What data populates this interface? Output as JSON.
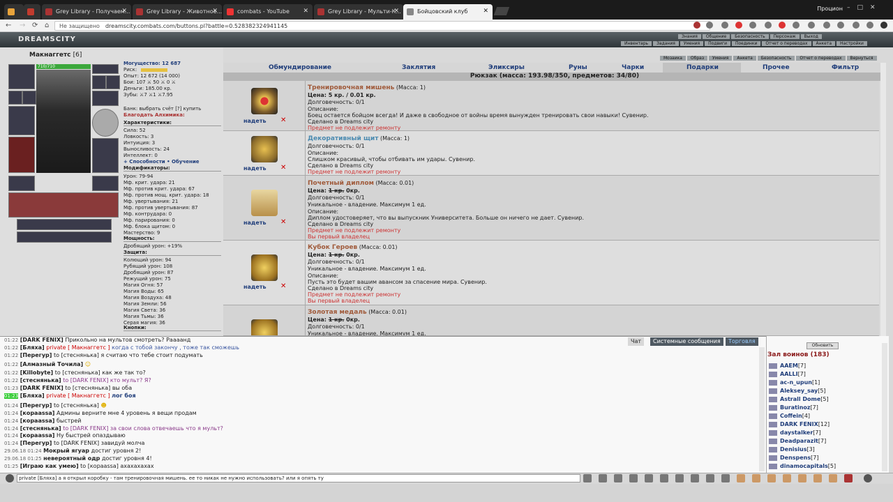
{
  "browser": {
    "tabs": [
      {
        "label": "Grey Library - Получаем..."
      },
      {
        "label": "Grey Library - Животное..."
      },
      {
        "label": "combats - YouTube"
      },
      {
        "label": "Grey Library - Мульти-К..."
      },
      {
        "label": "Бойцовский клуб"
      }
    ],
    "profile": "Процион",
    "security": "Не защищено",
    "url": "dreamscity.combats.com/buttons.pl?battle=0.528382324941145"
  },
  "game": {
    "logo": "DREAMSCITY",
    "menu_top": [
      "Знания",
      "Общение",
      "Безопасность",
      "Персонаж",
      "Выход"
    ],
    "menu_bottom": [
      "Инвентарь",
      "Задания",
      "Умения",
      "Подвиги",
      "Поединки",
      "Отчет о переводах",
      "Анкета",
      "Настройки"
    ],
    "menu_inv": [
      "Мозаика",
      "Образ",
      "Умения",
      "Анкета",
      "Безопасность",
      "Отчет о переводах",
      "Вернуться"
    ]
  },
  "character": {
    "name": "Макнаггетс",
    "level": "[6]",
    "hp": "710/710",
    "stats": [
      "Могущество: 12 687",
      "Риск:",
      "Опыт: 12 672 (14 000)",
      "Бои: 107 ⚔ 50 ⚔ 0 ⚔",
      "Деньги: 185.00 кр.",
      "Зубы: ⚔7 ⚔1 ⚔7.95"
    ],
    "bank": "Банк: выбрать счёт [?] купить",
    "blessing": "Благодать Алхимика:",
    "characteristics_title": "Характеристики:",
    "characteristics": [
      "Сила: 52",
      "Ловкость: 3",
      "Интуиция: 3",
      "Выносливость: 24",
      "Интеллект: 0"
    ],
    "links": "+ Способности • Обучение",
    "modifiers_title": "Модификаторы:",
    "modifiers": [
      "Урон: 79-94",
      "Мф. крит. удара: 21",
      "Мф. против крит. удара: 67",
      "Мф. против мощ. крит. удара: 18",
      "Мф. увертывания: 21",
      "Мф. против увертывания: 87",
      "Мф. контрудара: 0",
      "Мф. парирования: 0",
      "Мф. блока щитом: 0",
      "Мастерство: 9"
    ],
    "power_title": "Мощность:",
    "power": [
      "Дробящий урон: +19%"
    ],
    "defense_title": "Защита:",
    "defense": [
      "Колющий урон: 94",
      "Рубящий урон: 108",
      "Дробящий урон: 87",
      "Режущий урон: 75",
      "Магия Огня: 57",
      "Магия Воды: 65",
      "Магия Воздуха: 48",
      "Магия Земли: 56",
      "Магия Света: 36",
      "Магия Тьмы: 36",
      "Серая магия: 36"
    ],
    "buttons_title": "Кнопки:"
  },
  "inventory": {
    "tabs": [
      "Обмундирование",
      "Заклятия",
      "Эликсиры",
      "Руны",
      "Чарки",
      "Подарки",
      "Прочее",
      "Фильтр"
    ],
    "backpack": "Рюкзак (масса: 193.98/350, предметов: 34/80)",
    "put_on": "надеть",
    "items": [
      {
        "name": "Тренировочная мишень",
        "mass": "(Масса: 1)",
        "price": "Цена: 5 кр. / 0.01 кр.",
        "durability": "Долговечность: 0/1",
        "unique": "",
        "desc_label": "Описание:",
        "desc": "Боец остается бойцом всегда! И даже в свободное от войны время вынужден тренировать свои навыки! Сувенир.",
        "made": "Сделано в Dreams city",
        "norepair": "Предмет не подлежит ремонту",
        "owner": "",
        "price_old": "",
        "price_new": ""
      },
      {
        "name": "Декоративный щит",
        "mass": "(Масса: 1)",
        "price": "",
        "durability": "Долговечность: 0/1",
        "unique": "",
        "desc_label": "Описание:",
        "desc": "Слишком красивый, чтобы отбивать им удары. Сувенир.",
        "made": "Сделано в Dreams city",
        "norepair": "Предмет не подлежит ремонту",
        "owner": "",
        "price_old": "",
        "price_new": ""
      },
      {
        "name": "Почетный диплом",
        "mass": "(Масса: 0.01)",
        "price": "Цена:",
        "price_old": "1 кр.",
        "price_new": "0кр.",
        "durability": "Долговечность: 0/1",
        "unique": "Уникальное - владение. Максимум 1 ед.",
        "desc_label": "Описание:",
        "desc": "Диплом удостоверяет, что вы выпускник Университета. Больше он ничего не дает. Сувенир.",
        "made": "Сделано в Dreams city",
        "norepair": "Предмет не подлежит ремонту",
        "owner": "Вы первый владелец"
      },
      {
        "name": "Кубок Героев",
        "mass": "(Масса: 0.01)",
        "price": "Цена:",
        "price_old": "1 кр.",
        "price_new": "0кр.",
        "durability": "Долговечность: 0/1",
        "unique": "Уникальное - владение. Максимум 1 ед.",
        "desc_label": "Описание:",
        "desc": "Пусть это будет вашим авансом за спасение мира. Сувенир.",
        "made": "Сделано в Dreams city",
        "norepair": "Предмет не подлежит ремонту",
        "owner": "Вы первый владелец"
      },
      {
        "name": "Золотая медаль",
        "mass": "(Масса: 0.01)",
        "price": "Цена:",
        "price_old": "1 кр.",
        "price_new": "0кр.",
        "durability": "Долговечность: 0/1",
        "unique": "Уникальное - владение. Максимум 1 ед.",
        "desc_label": "",
        "desc": "",
        "made": "",
        "norepair": "",
        "owner": ""
      }
    ]
  },
  "chat": {
    "tabs": [
      "Чат",
      "Системные сообщения",
      "Торговля"
    ],
    "lines": [
      {
        "ts": "01:22",
        "nick": "[DARK FENIX]",
        "to": "",
        "text": "Прикольно на мультов смотреть? Раааанд"
      },
      {
        "ts": "01:22",
        "nick": "[Бляха]",
        "to": "private [ Макнаггетс ]",
        "text": "когда с тобой закончу , тоже так сможешь"
      },
      {
        "ts": "01:22",
        "nick": "[Перегур]",
        "to": "to [стеснянька]",
        "text": "я считаю что тебе стоит подумать"
      },
      {
        "ts": "01:22",
        "nick": "[Алмазный Точила]",
        "to": "",
        "text": ""
      },
      {
        "ts": "01:22",
        "nick": "[Killobyte]",
        "to": "to [стеснянька]",
        "text": "как же так то?"
      },
      {
        "ts": "01:22",
        "nick": "[стеснянька]",
        "to": "to [DARK FENIX]",
        "text": "кто мульт? Я?"
      },
      {
        "ts": "01:23",
        "nick": "[DARK FENIX]",
        "to": "to [стеснянька]",
        "text": "вы оба"
      },
      {
        "ts": "01:23",
        "nick": "[Бляха]",
        "to": "private [ Макнаггетс ]",
        "text": "лог боя"
      },
      {
        "ts": "01:24",
        "nick": "[Перегур]",
        "to": "to [стеснянька]",
        "text": ""
      },
      {
        "ts": "01:24",
        "nick": "[корааssa]",
        "to": "",
        "text": "Админы верните мне 4 уровень я вещи продам"
      },
      {
        "ts": "01:24",
        "nick": "[корааssa]",
        "to": "",
        "text": "быстрей"
      },
      {
        "ts": "01:24",
        "nick": "[стеснянька]",
        "to": "to [DARK FENIX]",
        "text": "за свои слова отвечаешь что я мульт?"
      },
      {
        "ts": "01:24",
        "nick": "[корааssa]",
        "to": "",
        "text": "Ну быстрей опаздываю"
      },
      {
        "ts": "01:24",
        "nick": "[Перегур]",
        "to": "to [DARK FENIX]",
        "text": "завидуй молча"
      },
      {
        "ts": "29.06.18 01:24",
        "nick": "Мокрый ягуар",
        "to": "",
        "text": "достиг уровня 2!"
      },
      {
        "ts": "29.06.18 01:25",
        "nick": "невероятный одр",
        "to": "",
        "text": "достиг уровня 4!"
      },
      {
        "ts": "01:25",
        "nick": "[Играю как умею]",
        "to": "to [кораassa]",
        "text": "ахахахахах"
      }
    ],
    "input": "private [Бляха]  а я открыл коробку - там тренировочная мишень. ее то никак не нужно использовать? или я опять ту"
  },
  "online": {
    "refresh": "Обновить",
    "title": "Зал воинов (183)",
    "users": [
      {
        "name": "AAEM",
        "lvl": "[7]"
      },
      {
        "name": "AALLI",
        "lvl": "[7]"
      },
      {
        "name": "ac-n_upun",
        "lvl": "[1]"
      },
      {
        "name": "Aleksey_say",
        "lvl": "[5]"
      },
      {
        "name": "Astrall Dome",
        "lvl": "[5]"
      },
      {
        "name": "Buratinoz",
        "lvl": "[7]"
      },
      {
        "name": "Coffein",
        "lvl": "[4]"
      },
      {
        "name": "DARK FENIX",
        "lvl": "[12]"
      },
      {
        "name": "daystalker",
        "lvl": "[7]"
      },
      {
        "name": "Deadparazit",
        "lvl": "[7]"
      },
      {
        "name": "Denisius",
        "lvl": "[3]"
      },
      {
        "name": "Denspens",
        "lvl": "[7]"
      },
      {
        "name": "dinamocapitals",
        "lvl": "[5]"
      }
    ]
  },
  "colors": {
    "accent": "#1f3d7a",
    "private": "#cc0000",
    "hp": "#3ca83c",
    "header": "#2e3538"
  }
}
